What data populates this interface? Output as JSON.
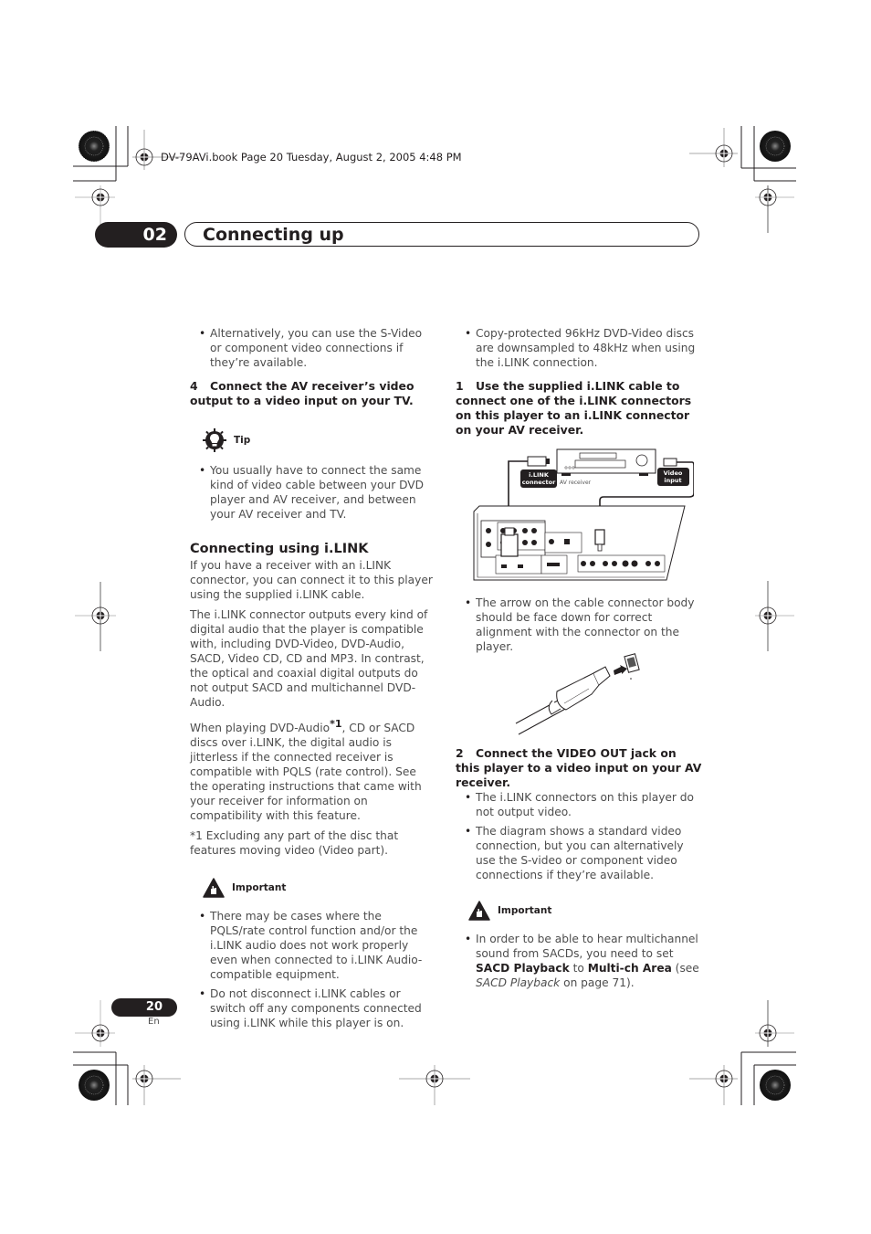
{
  "print_info": "DV-79AVi.book  Page 20  Tuesday, August 2, 2005  4:48 PM",
  "chapter": {
    "number": "02",
    "title": "Connecting up"
  },
  "left_column": {
    "intro_bullet": "Alternatively, you can use the S-Video or component video connections if they’re available.",
    "step4": {
      "num": "4",
      "text": "Connect the AV receiver’s video output to a video input on your TV."
    },
    "tip": {
      "label": "Tip",
      "bullets": [
        "You usually have to connect the same kind of video cable between your DVD player and AV receiver, and between your AV receiver and TV."
      ]
    },
    "section_heading": "Connecting using i.LINK",
    "para1": "If you have a receiver with an i.LINK connector, you can connect it to this player using the supplied i.LINK cable.",
    "para2": "The i.LINK connector outputs every kind of digital audio that the player is compatible with, including DVD-Video, DVD-Audio, SACD, Video CD, CD and MP3. In contrast, the optical and coaxial digital outputs do not output SACD and multichannel DVD-Audio.",
    "para3_before": "When playing DVD-Audio",
    "para3_sup": "*1",
    "para3_after": ", CD or SACD discs over i.LINK, the digital audio is jitterless if the connected receiver is compatible with PQLS (rate control). See the operating instructions that came with your receiver for information on compatibility with this feature.",
    "footnote": "*1 Excluding any part of the disc that features moving video (Video part).",
    "important": {
      "label": "Important",
      "bullets": [
        "There may be cases where the PQLS/rate control function and/or the i.LINK audio does not work properly even when connected to i.LINK Audio-compatible equipment.",
        "Do not disconnect i.LINK cables or switch off any components connected using i.LINK while this player is on."
      ]
    }
  },
  "right_column": {
    "intro_bullet": "Copy-protected 96kHz DVD-Video discs are downsampled to 48kHz when using the i.LINK connection.",
    "step1": {
      "num": "1",
      "text": "Use the supplied i.LINK cable to connect one of the i.LINK connectors on this player to an i.LINK connector on your AV receiver."
    },
    "diagram": {
      "ilink_label_line1": "i.LINK",
      "ilink_label_line2": "connector",
      "receiver_label": "AV receiver",
      "video_label_line1": "Video",
      "video_label_line2": "input"
    },
    "arrow_bullet": "The arrow on the cable connector body should be face down for correct alignment with the connector on the player.",
    "step2": {
      "num": "2",
      "text": "Connect the VIDEO OUT jack on this player to a video input on your AV receiver."
    },
    "step2_bullets": [
      "The i.LINK connectors on this player do not output video.",
      "The diagram shows a standard video connection, but you can alternatively use the S-video or component video connections if they’re available."
    ],
    "important": {
      "label": "Important",
      "text_1": "In order to be able to hear multichannel sound from SACDs, you need to set ",
      "bold_1": "SACD Playback",
      "text_2": " to ",
      "bold_2": "Multi-ch Area",
      "text_3": " (see ",
      "italic_1": "SACD Playback",
      "text_4": " on page 71)."
    }
  },
  "footer": {
    "page_number": "20",
    "language": "En"
  }
}
